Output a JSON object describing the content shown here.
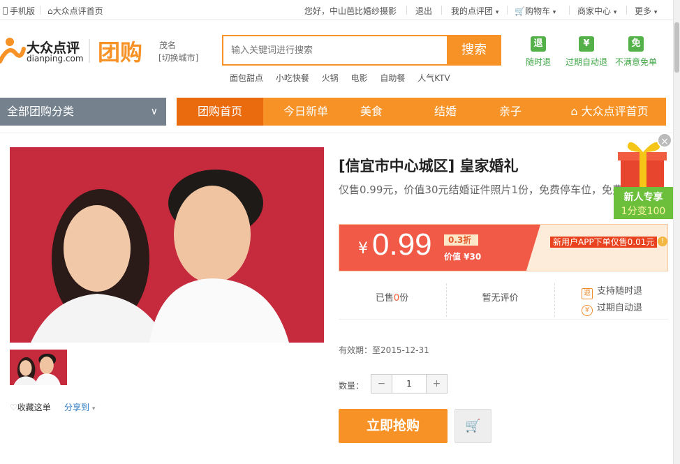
{
  "topbar": {
    "mobile": "手机版",
    "home": "大众点评首页",
    "greeting": "您好，中山芭比婚纱摄影",
    "logout": "退出",
    "my_account": "我的点评团",
    "cart": "购物车",
    "merchant": "商家中心",
    "more": "更多"
  },
  "header": {
    "logo_cn": "大众点评",
    "logo_en": "dianping.com",
    "tuangou": "团购",
    "city": "茂名",
    "switch_city": "[切换城市]",
    "search_placeholder": "输入关键词进行搜索",
    "search_button": "搜索",
    "hotwords": [
      "面包甜点",
      "小吃快餐",
      "火锅",
      "电影",
      "自助餐",
      "人气KTV"
    ],
    "promises": [
      {
        "icon": "退",
        "label": "随时退"
      },
      {
        "icon": "¥",
        "label": "过期自动退"
      },
      {
        "icon": "免",
        "label": "不满意免单"
      }
    ]
  },
  "nav": {
    "all_categories": "全部团购分类",
    "tabs": [
      "团购首页",
      "今日新单",
      "美食",
      "结婚",
      "亲子",
      "大众点评首页"
    ]
  },
  "deal": {
    "title": "[信宜市中心城区] 皇家婚礼",
    "description": "仅售0.99元，价值30元结婚证件照片1份，免费停车位，免费WiFi！",
    "price_symbol": "¥",
    "price": "0.99",
    "discount": "0.3折",
    "original_value": "价值 ¥30",
    "new_user_offer": "新用户APP下单仅售0.01元",
    "sold_prefix": "已售",
    "sold_count": "0",
    "sold_suffix": "份",
    "reviews": "暂无评价",
    "guarantee_refund": "支持随时退",
    "guarantee_expired": "过期自动退",
    "validity": "有效期：至2015-12-31",
    "quantity_label": "数量：",
    "quantity": "1",
    "buy_button": "立即抢购",
    "favorite": "收藏这单",
    "share": "分享到"
  },
  "gift": {
    "line1": "新人专享",
    "line2": "1分变100"
  },
  "colors": {
    "brand_orange": "#f79226",
    "price_red": "#f05a47",
    "promise_green": "#54b14a"
  }
}
